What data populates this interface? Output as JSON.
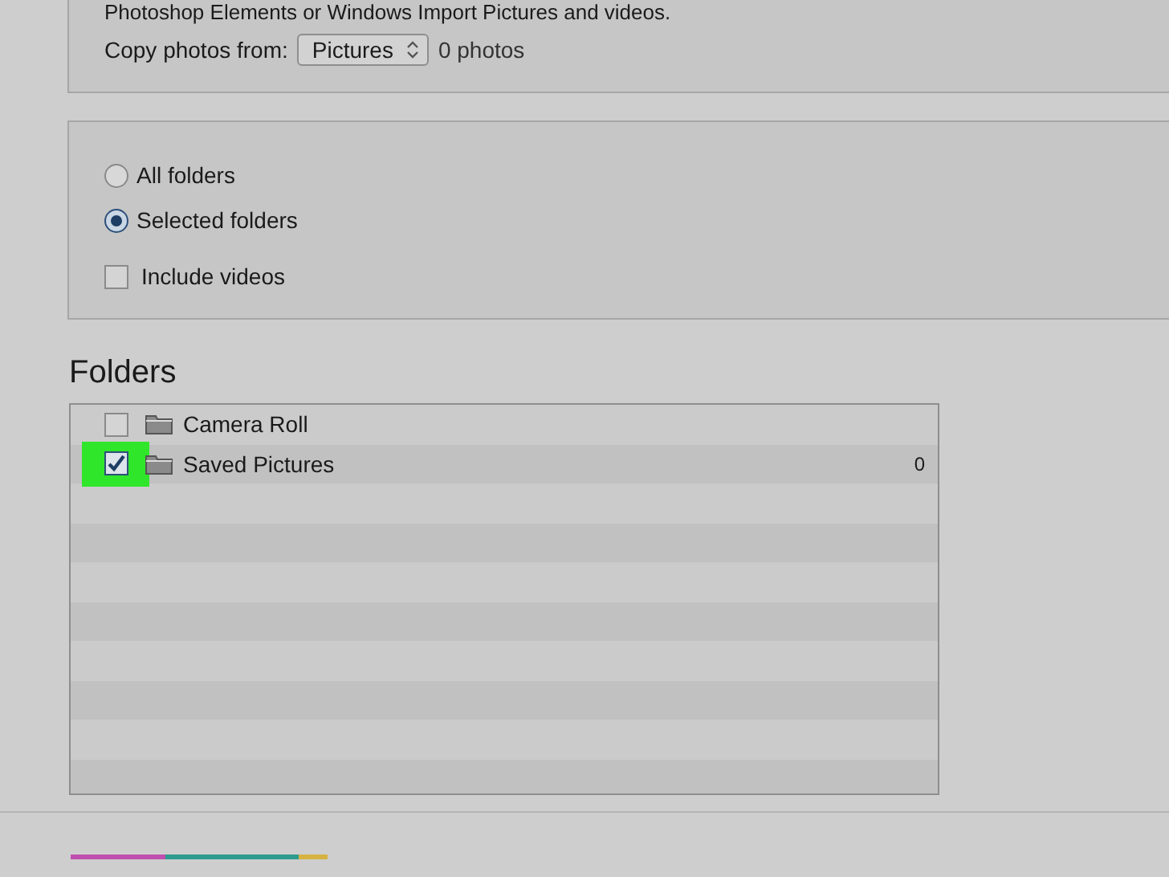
{
  "source": {
    "intro": "Photoshop Elements or Windows Import Pictures and videos.",
    "copy_label": "Copy photos from:",
    "dropdown": {
      "value": "Pictures"
    },
    "photo_count": "0 photos"
  },
  "options": {
    "radios": [
      {
        "label": "All folders",
        "selected": false
      },
      {
        "label": "Selected folders",
        "selected": true
      }
    ],
    "include_videos": {
      "label": "Include videos",
      "checked": false
    }
  },
  "folders": {
    "heading": "Folders",
    "items": [
      {
        "name": "Camera Roll",
        "checked": false,
        "highlighted": false
      },
      {
        "name": "Saved Pictures",
        "checked": true,
        "highlighted": true,
        "count": "0"
      }
    ]
  }
}
